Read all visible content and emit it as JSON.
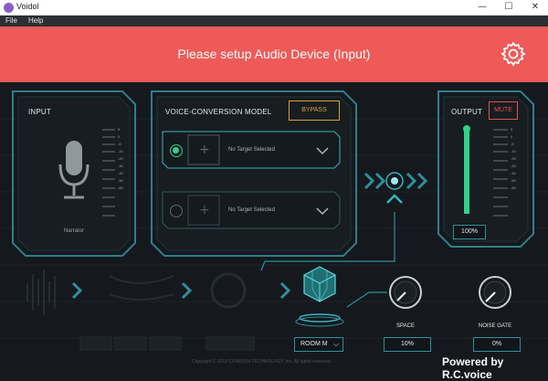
{
  "window": {
    "title": "Voidol",
    "minimize": "—",
    "maximize": "☐",
    "close": "✕"
  },
  "menu": {
    "file": "File",
    "help": "Help"
  },
  "banner": {
    "message": "Please setup Audio Device (Input)",
    "color": "#ee5a57"
  },
  "input_panel": {
    "title": "INPUT",
    "voice_name": "Narrator",
    "meter_ticks": [
      "5",
      "0",
      "-5",
      "-10",
      "-20",
      "-30",
      "-40",
      "-50",
      "-60"
    ]
  },
  "conversion_panel": {
    "title": "VOICE-CONVERSION MODEL",
    "bypass_label": "BYPASS",
    "slots": [
      {
        "label": "No Target Selected",
        "selected": true
      },
      {
        "label": "No Target Selected",
        "selected": false
      }
    ]
  },
  "output_panel": {
    "title": "OUTPUT",
    "mute_label": "MUTE",
    "volume": "100%",
    "volume_fraction": 1.0,
    "meter_ticks": [
      "5",
      "0",
      "-5",
      "-10",
      "-20",
      "-30",
      "-40",
      "-50",
      "-60"
    ]
  },
  "room": {
    "label": "ROOM M"
  },
  "space": {
    "label": "SPACE",
    "value": "10%"
  },
  "noise_gate": {
    "label": "NOISE GATE",
    "value": "0%"
  },
  "footer": {
    "copyright": "Copyright © 2019 CRIMSON TECHNOLOGY, Inc. All rights reserved.",
    "powered_by": "Powered by R.C.voice"
  },
  "colors": {
    "accent": "#34b4c4",
    "green": "#2fd28a",
    "mute": "#e05050",
    "bypass": "#e0a030"
  }
}
